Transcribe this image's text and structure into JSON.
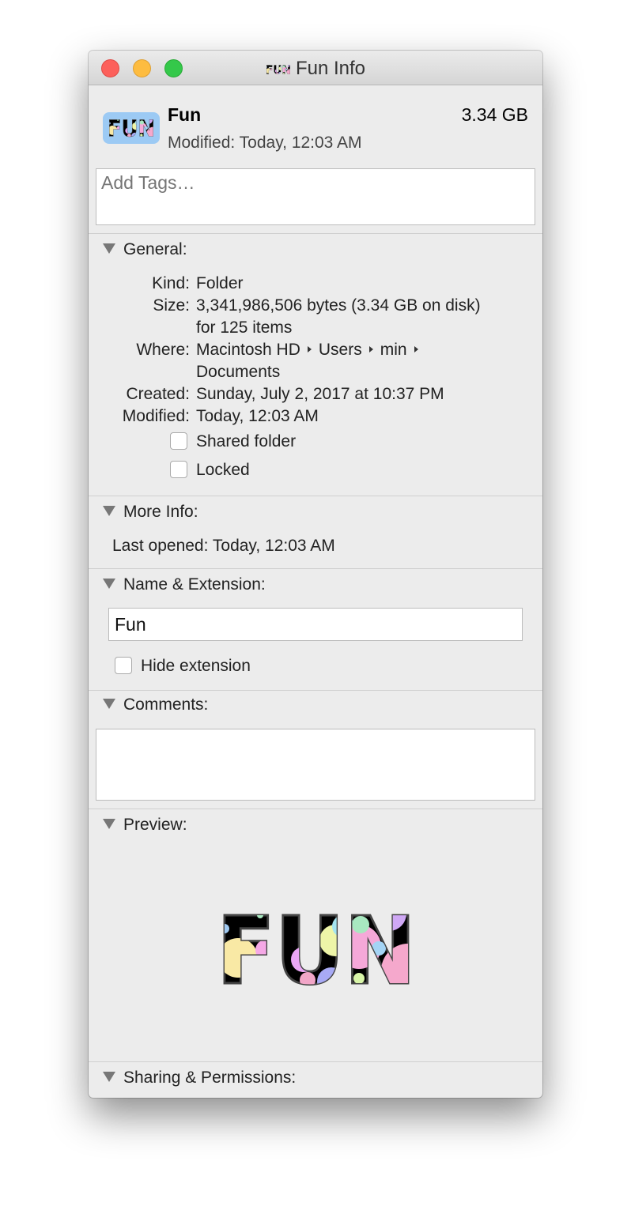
{
  "window": {
    "title": "Fun Info"
  },
  "header": {
    "name": "Fun",
    "size": "3.34 GB",
    "modified": "Modified: Today, 12:03 AM",
    "tags_placeholder": "Add Tags…"
  },
  "general": {
    "title": "General:",
    "kind_label": "Kind:",
    "kind": "Folder",
    "size_label": "Size:",
    "size": "3,341,986,506 bytes (3.34 GB on disk)",
    "size2": "for 125 items",
    "where_label": "Where:",
    "where": [
      "Macintosh HD",
      "Users",
      "min"
    ],
    "where2": "Documents",
    "created_label": "Created:",
    "created": "Sunday, July 2, 2017 at 10:37 PM",
    "modified_label": "Modified:",
    "modified": "Today, 12:03 AM",
    "shared_label": "Shared folder",
    "shared": false,
    "locked_label": "Locked",
    "locked": false
  },
  "more_info": {
    "title": "More Info:",
    "last_opened": "Last opened: Today, 12:03 AM"
  },
  "name_ext": {
    "title": "Name & Extension:",
    "name": "Fun",
    "hide_label": "Hide extension",
    "hide": false
  },
  "comments": {
    "title": "Comments:",
    "value": ""
  },
  "preview": {
    "title": "Preview:",
    "logo_text": "FUN"
  },
  "sharing": {
    "title": "Sharing & Permissions:"
  }
}
